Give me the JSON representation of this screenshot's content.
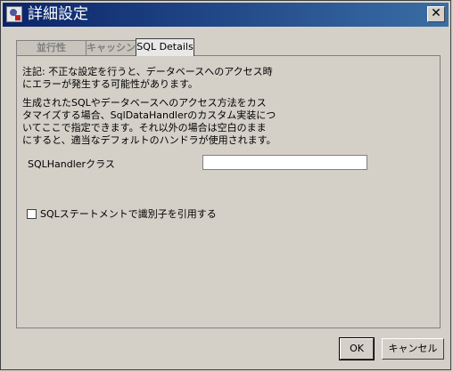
{
  "window": {
    "title": "詳細設定",
    "close_label": "✕"
  },
  "tabs": [
    {
      "label": "並行性",
      "active": false
    },
    {
      "label": "キャッシング",
      "active": false
    },
    {
      "label": "SQL Details",
      "active": true
    }
  ],
  "content": {
    "warning": [
      "注記: 不正な設定を行うと、データベースへのアクセス時",
      "にエラーが発生する可能性があります。"
    ],
    "description": [
      "生成されたSQLやデータベースへのアクセス方法をカス",
      "タマイズする場合、SqlDataHandlerのカスタム実装につ",
      "いてここで指定できます。それ以外の場合は空白のまま",
      "にすると、適当なデフォルトのハンドラが使用されます。"
    ],
    "handler_label": "SQLHandlerクラス",
    "handler_value": "",
    "quote_identifiers_label": "SQLステートメントで識別子を引用する",
    "quote_identifiers_checked": false
  },
  "buttons": {
    "ok": "OK",
    "cancel": "キャンセル"
  }
}
